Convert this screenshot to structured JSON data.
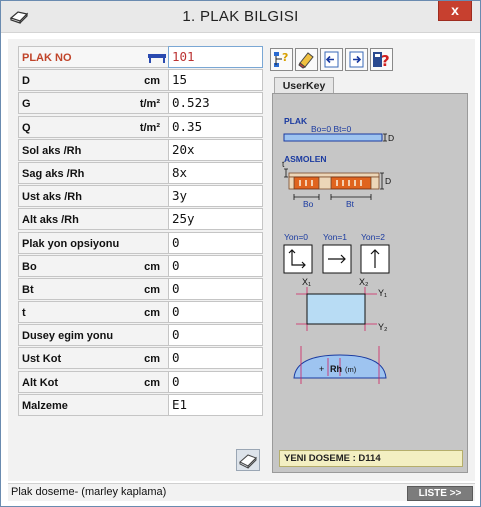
{
  "window": {
    "title": "1.  PLAK  BILGISI",
    "close_label": "x"
  },
  "form": {
    "rows": [
      {
        "label": "PLAK NO",
        "unit": "",
        "value": "101"
      },
      {
        "label": "D",
        "unit": "cm",
        "value": "15"
      },
      {
        "label": "G",
        "unit": "t/m²",
        "value": "0.523"
      },
      {
        "label": "Q",
        "unit": "t/m²",
        "value": "0.35"
      },
      {
        "label": "Sol aks /Rh",
        "unit": "",
        "value": "20x"
      },
      {
        "label": "Sag aks /Rh",
        "unit": "",
        "value": "8x"
      },
      {
        "label": "Ust aks /Rh",
        "unit": "",
        "value": "3y"
      },
      {
        "label": "Alt aks /Rh",
        "unit": "",
        "value": "25y"
      },
      {
        "label": "Plak yon opsiyonu",
        "unit": "",
        "value": "0"
      },
      {
        "label": "Bo",
        "unit": "cm",
        "value": "0"
      },
      {
        "label": "Bt",
        "unit": "cm",
        "value": "0"
      },
      {
        "label": "t",
        "unit": "cm",
        "value": "0"
      },
      {
        "label": "Dusey egim yonu",
        "unit": "",
        "value": "0"
      },
      {
        "label": "Ust Kot",
        "unit": "cm",
        "value": "0"
      },
      {
        "label": "Alt Kot",
        "unit": "cm",
        "value": "0"
      },
      {
        "label": "Malzeme",
        "unit": "",
        "value": "E1"
      }
    ]
  },
  "panel": {
    "tab_label": "UserKey",
    "diagram": {
      "plak": "PLAK",
      "plak_params": "Bo=0  Bt=0",
      "d_label": "D",
      "asmolen": "ASMOLEN",
      "t_label": "t",
      "bo_label": "Bo",
      "bt_label": "Bt",
      "yon0": "Yon=0",
      "yon1": "Yon=1",
      "yon2": "Yon=2",
      "x1": "X₁",
      "x2": "X₂",
      "y1": "Y₁",
      "y2": "Y₂",
      "plus": "+",
      "rh": "Rh",
      "rh_unit": "(m)"
    },
    "status": "YENI DOSEME : D114"
  },
  "statusbar": {
    "text": "Plak doseme- (marley kaplama)",
    "liste_label": "LISTE >>"
  },
  "colors": {
    "accent_red": "#c0442a",
    "panel_bg": "#c6c6c6",
    "diagram_blue": "#1a3aa0"
  }
}
